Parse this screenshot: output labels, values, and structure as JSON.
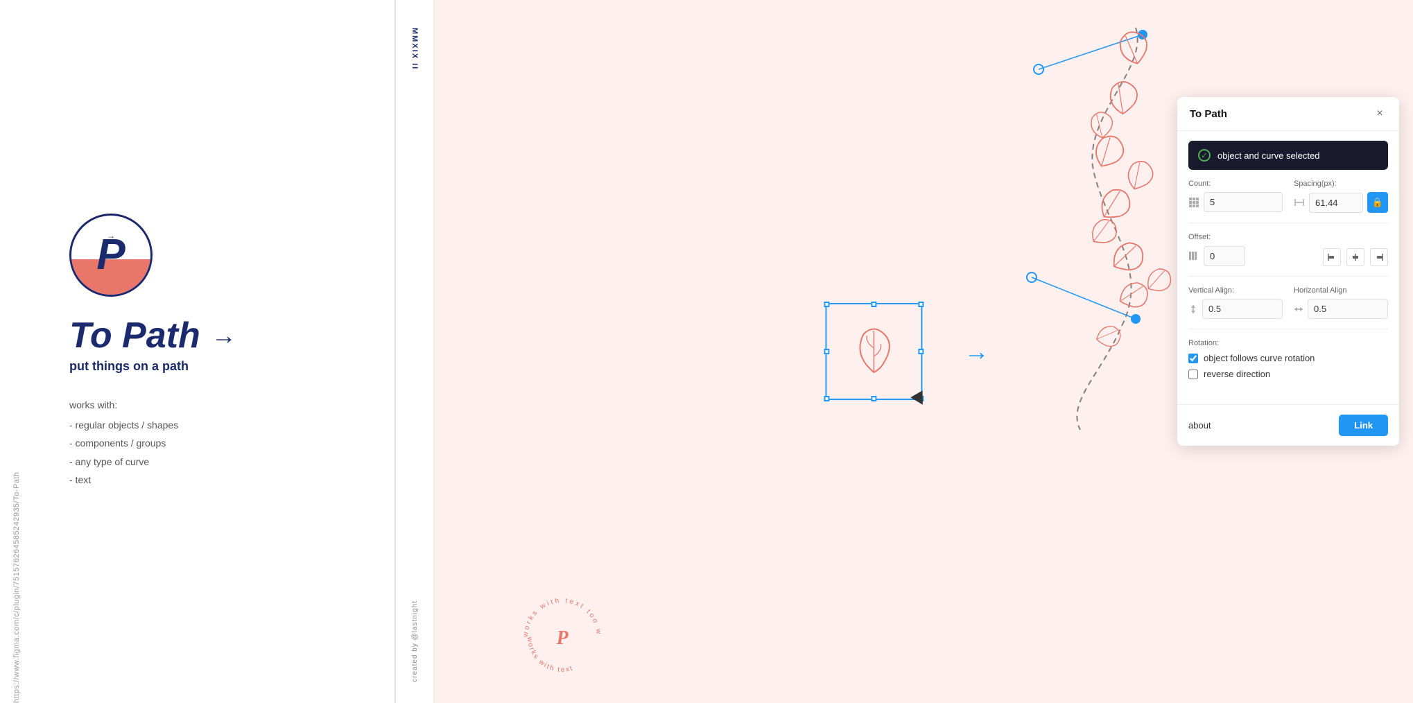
{
  "url": "https://www.figma.com/c/plugin/751576264585242935/To-Path",
  "strip": {
    "top_text": "MMXIX II",
    "bottom_text": "created by @lastnight"
  },
  "left_panel": {
    "title": "To Path",
    "arrow": "→",
    "subtitle": "put things on a path",
    "works_with_label": "works with:",
    "items": [
      "- regular objects / shapes",
      "- components / groups",
      "- any type of curve",
      "- text"
    ]
  },
  "plugin": {
    "title": "To Path",
    "close_label": "×",
    "status": {
      "text": "object and curve selected",
      "icon": "✓"
    },
    "count": {
      "label": "Count:",
      "value": "5"
    },
    "spacing": {
      "label": "Spacing(px):",
      "value": "61.44"
    },
    "offset": {
      "label": "Offset:",
      "value": "0"
    },
    "vertical_align": {
      "label": "Vertical Align:",
      "value": "0.5"
    },
    "horizontal_align": {
      "label": "Horizontal Align",
      "value": "0.5"
    },
    "rotation": {
      "label": "Rotation:",
      "follows_curve_label": "object follows curve rotation",
      "reverse_label": "reverse direction",
      "follows_curve_checked": true,
      "reverse_checked": false
    },
    "about_label": "about",
    "link_label": "Link"
  }
}
